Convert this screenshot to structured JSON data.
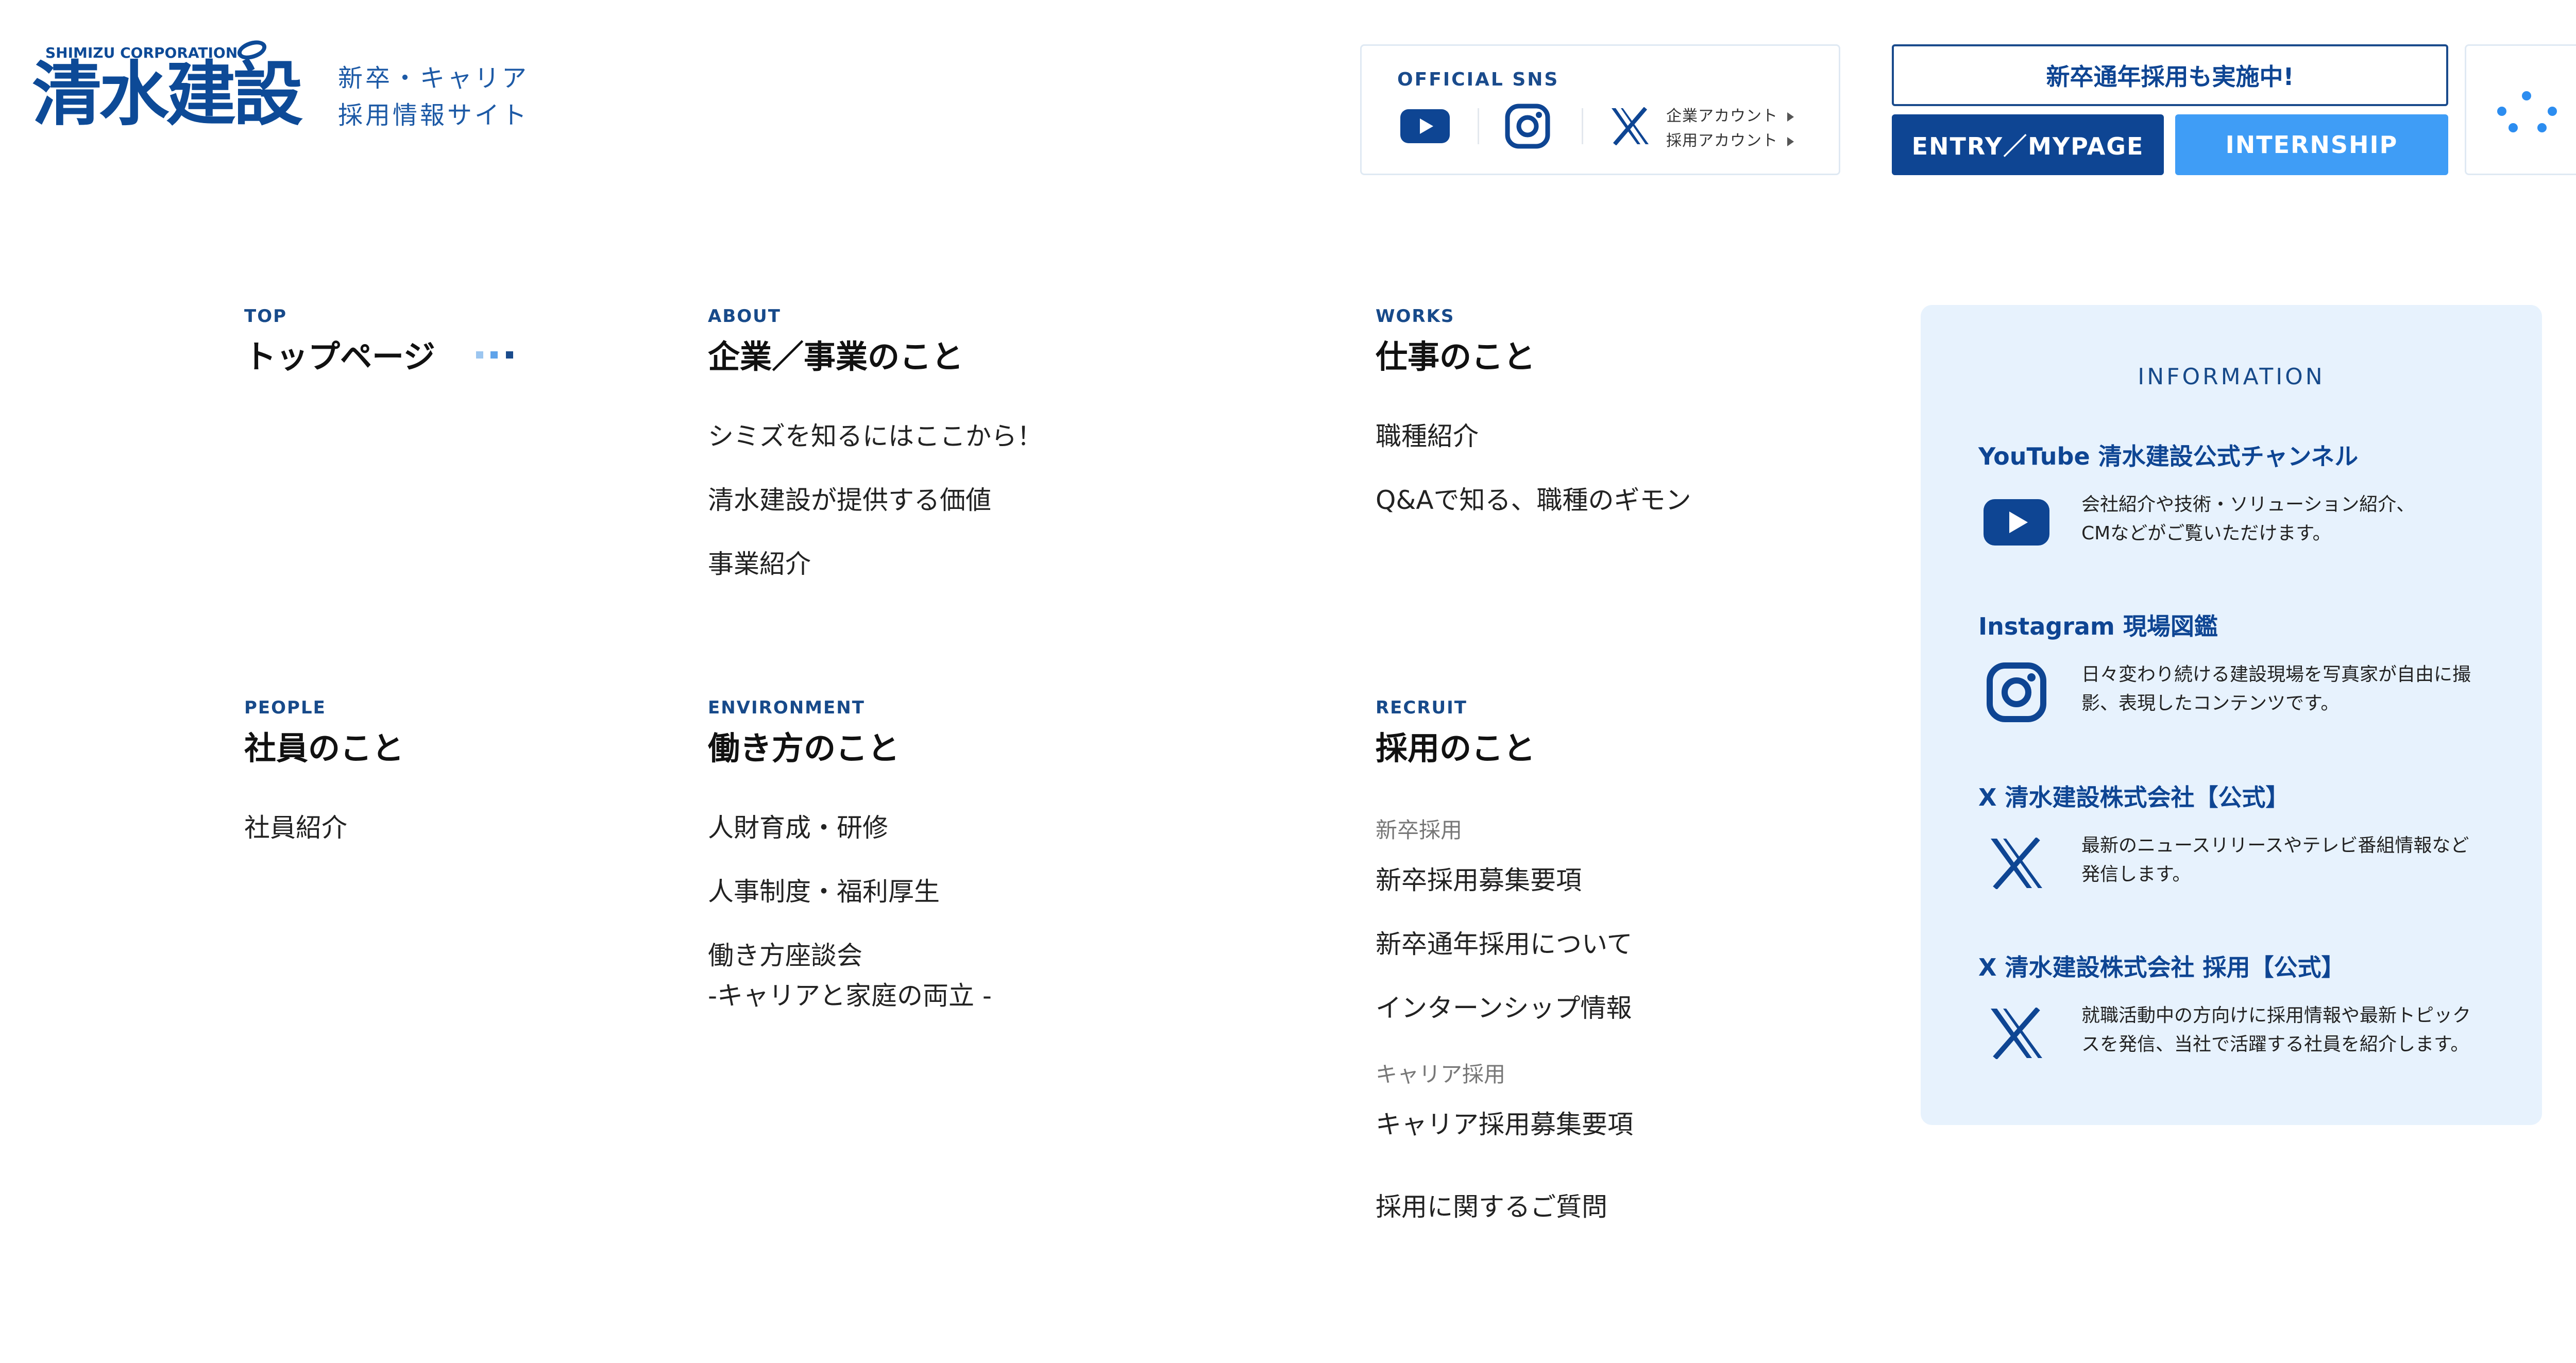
{
  "header": {
    "logo_en": "SHIMIZU CORPORATION",
    "logo_jp": "清水建設",
    "subtitle_line1": "新卒・キャリア",
    "subtitle_line2": "採用情報サイト",
    "sns_label": "OFFICIAL SNS",
    "sns_account_corp": "企業アカウント",
    "sns_account_recruit": "採用アカウント",
    "btn_year_round": "新卒通年採用も実施中!",
    "btn_entry": "ENTRY／MYPAGE",
    "btn_internship": "INTERNSHIP"
  },
  "nav": {
    "top": {
      "en": "TOP",
      "jp": "トップページ"
    },
    "about": {
      "en": "ABOUT",
      "jp": "企業／事業のこと",
      "links": [
        "シミズを知るにはここから！",
        "清水建設が提供する価値",
        "事業紹介"
      ]
    },
    "works": {
      "en": "WORKS",
      "jp": "仕事のこと",
      "links": [
        "職種紹介",
        "Q&Aで知る、職種のギモン"
      ]
    },
    "people": {
      "en": "PEOPLE",
      "jp": "社員のこと",
      "links": [
        "社員紹介"
      ]
    },
    "environment": {
      "en": "ENVIRONMENT",
      "jp": "働き方のこと",
      "links": [
        "人財育成・研修",
        "人事制度・福利厚生",
        "働き方座談会",
        "-キャリアと家庭の両立 -"
      ]
    },
    "recruit": {
      "en": "RECRUIT",
      "jp": "採用のこと",
      "cat_new": "新卒採用",
      "new_links": [
        "新卒採用募集要項",
        "新卒通年採用について",
        "インターンシップ情報"
      ],
      "cat_career": "キャリア採用",
      "career_links": [
        "キャリア採用募集要項"
      ],
      "faq": "採用に関するご質問"
    }
  },
  "info": {
    "title": "INFORMATION",
    "items": [
      {
        "head": "YouTube 清水建設公式チャンネル",
        "desc1": "会社紹介や技術・ソリューション紹介、",
        "desc2": "CMなどがご覧いただけます。",
        "icon": "youtube-icon"
      },
      {
        "head": "Instagram 現場図鑑",
        "desc1": "日々変わり続ける建設現場を写真家が自由に撮",
        "desc2": "影、表現したコンテンツです。",
        "icon": "instagram-icon"
      },
      {
        "head": "X 清水建設株式会社【公式】",
        "desc1": "最新のニュースリリースやテレビ番組情報など",
        "desc2": "発信します。",
        "icon": "x-icon"
      },
      {
        "head": "X 清水建設株式会社 採用【公式】",
        "desc1": "就職活動中の方向けに採用情報や最新トピック",
        "desc2": "スを発信、当社で活躍する社員を紹介します。",
        "icon": "x-icon"
      }
    ]
  },
  "colors": {
    "brand_navy": "#0e4593",
    "accent_blue": "#3f9df6",
    "panel_bg": "#e7f2fd"
  }
}
